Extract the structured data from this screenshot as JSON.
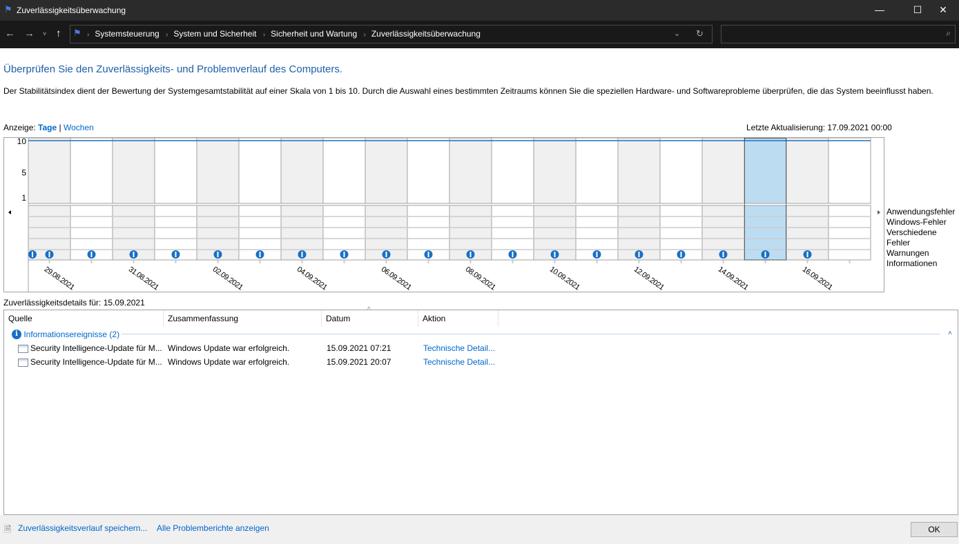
{
  "window": {
    "title": "Zuverlässigkeitsüberwachung"
  },
  "address": {
    "breadcrumbs": [
      "Systemsteuerung",
      "System und Sicherheit",
      "Sicherheit und Wartung",
      "Zuverlässigkeitsüberwachung"
    ]
  },
  "heading": "Überprüfen Sie den Zuverlässigkeits- und Problemverlauf des Computers.",
  "description": "Der Stabilitätsindex dient der Bewertung der Systemgesamtstabilität auf einer Skala von 1 bis 10. Durch die Auswahl eines bestimmten Zeitraums können Sie die speziellen Hardware- und Softwareprobleme überprüfen, die das System beeinflusst haben.",
  "view": {
    "label": "Anzeige:",
    "days": "Tage",
    "divider": "|",
    "weeks": "Wochen"
  },
  "last_update": "Letzte Aktualisierung: 17.09.2021 00:00",
  "chart_data": {
    "type": "line",
    "title": "Stabilitätsindex",
    "y_ticks": [
      "10",
      "5",
      "1"
    ],
    "ylim": [
      1,
      10
    ],
    "days": [
      "29.08",
      "30.08",
      "31.08",
      "01.09",
      "02.09",
      "03.09",
      "04.09",
      "05.09",
      "06.09",
      "07.09",
      "08.09",
      "09.09",
      "10.09",
      "11.09",
      "12.09",
      "13.09",
      "14.09",
      "15.09",
      "16.09",
      "17.09"
    ],
    "x_labels": [
      "29.08.2021",
      "31.08.2021",
      "02.09.2021",
      "04.09.2021",
      "06.09.2021",
      "08.09.2021",
      "10.09.2021",
      "12.09.2021",
      "14.09.2021",
      "16.09.2021"
    ],
    "stability": [
      10,
      10,
      10,
      10,
      10,
      10,
      10,
      10,
      10,
      10,
      10,
      10,
      10,
      10,
      10,
      10,
      10,
      10,
      10,
      10
    ],
    "information_events": [
      1,
      1,
      1,
      1,
      1,
      1,
      1,
      1,
      1,
      1,
      1,
      1,
      1,
      1,
      1,
      1,
      1,
      1,
      1,
      0
    ],
    "selected_day": "15.09",
    "legend": [
      "Anwendungsfehler",
      "Windows-Fehler",
      "Verschiedene Fehler",
      "Warnungen",
      "Informationen"
    ]
  },
  "details_label": "Zuverlässigkeitsdetails für: 15.09.2021",
  "table": {
    "columns": [
      "Quelle",
      "Zusammenfassung",
      "Datum",
      "Aktion"
    ],
    "group": "Informationsereignisse (2)",
    "rows": [
      {
        "source": "Security Intelligence-Update für M...",
        "summary": "Windows Update war erfolgreich.",
        "date": "15.09.2021 07:21",
        "action": "Technische Detail..."
      },
      {
        "source": "Security Intelligence-Update für M...",
        "summary": "Windows Update war erfolgreich.",
        "date": "15.09.2021 20:07",
        "action": "Technische Detail..."
      }
    ]
  },
  "footer": {
    "save": "Zuverlässigkeitsverlauf speichern...",
    "reports": "Alle Problemberichte anzeigen",
    "ok": "OK"
  }
}
